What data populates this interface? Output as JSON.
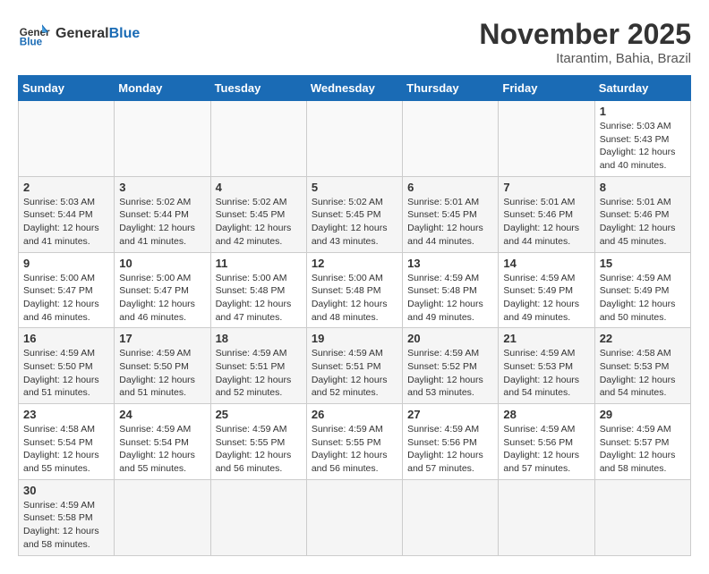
{
  "header": {
    "logo_general": "General",
    "logo_blue": "Blue",
    "month_title": "November 2025",
    "location": "Itarantim, Bahia, Brazil"
  },
  "days_of_week": [
    "Sunday",
    "Monday",
    "Tuesday",
    "Wednesday",
    "Thursday",
    "Friday",
    "Saturday"
  ],
  "weeks": [
    [
      {
        "day": "",
        "info": ""
      },
      {
        "day": "",
        "info": ""
      },
      {
        "day": "",
        "info": ""
      },
      {
        "day": "",
        "info": ""
      },
      {
        "day": "",
        "info": ""
      },
      {
        "day": "",
        "info": ""
      },
      {
        "day": "1",
        "info": "Sunrise: 5:03 AM\nSunset: 5:43 PM\nDaylight: 12 hours and 40 minutes."
      }
    ],
    [
      {
        "day": "2",
        "info": "Sunrise: 5:03 AM\nSunset: 5:44 PM\nDaylight: 12 hours and 41 minutes."
      },
      {
        "day": "3",
        "info": "Sunrise: 5:02 AM\nSunset: 5:44 PM\nDaylight: 12 hours and 41 minutes."
      },
      {
        "day": "4",
        "info": "Sunrise: 5:02 AM\nSunset: 5:45 PM\nDaylight: 12 hours and 42 minutes."
      },
      {
        "day": "5",
        "info": "Sunrise: 5:02 AM\nSunset: 5:45 PM\nDaylight: 12 hours and 43 minutes."
      },
      {
        "day": "6",
        "info": "Sunrise: 5:01 AM\nSunset: 5:45 PM\nDaylight: 12 hours and 44 minutes."
      },
      {
        "day": "7",
        "info": "Sunrise: 5:01 AM\nSunset: 5:46 PM\nDaylight: 12 hours and 44 minutes."
      },
      {
        "day": "8",
        "info": "Sunrise: 5:01 AM\nSunset: 5:46 PM\nDaylight: 12 hours and 45 minutes."
      }
    ],
    [
      {
        "day": "9",
        "info": "Sunrise: 5:00 AM\nSunset: 5:47 PM\nDaylight: 12 hours and 46 minutes."
      },
      {
        "day": "10",
        "info": "Sunrise: 5:00 AM\nSunset: 5:47 PM\nDaylight: 12 hours and 46 minutes."
      },
      {
        "day": "11",
        "info": "Sunrise: 5:00 AM\nSunset: 5:48 PM\nDaylight: 12 hours and 47 minutes."
      },
      {
        "day": "12",
        "info": "Sunrise: 5:00 AM\nSunset: 5:48 PM\nDaylight: 12 hours and 48 minutes."
      },
      {
        "day": "13",
        "info": "Sunrise: 4:59 AM\nSunset: 5:48 PM\nDaylight: 12 hours and 49 minutes."
      },
      {
        "day": "14",
        "info": "Sunrise: 4:59 AM\nSunset: 5:49 PM\nDaylight: 12 hours and 49 minutes."
      },
      {
        "day": "15",
        "info": "Sunrise: 4:59 AM\nSunset: 5:49 PM\nDaylight: 12 hours and 50 minutes."
      }
    ],
    [
      {
        "day": "16",
        "info": "Sunrise: 4:59 AM\nSunset: 5:50 PM\nDaylight: 12 hours and 51 minutes."
      },
      {
        "day": "17",
        "info": "Sunrise: 4:59 AM\nSunset: 5:50 PM\nDaylight: 12 hours and 51 minutes."
      },
      {
        "day": "18",
        "info": "Sunrise: 4:59 AM\nSunset: 5:51 PM\nDaylight: 12 hours and 52 minutes."
      },
      {
        "day": "19",
        "info": "Sunrise: 4:59 AM\nSunset: 5:51 PM\nDaylight: 12 hours and 52 minutes."
      },
      {
        "day": "20",
        "info": "Sunrise: 4:59 AM\nSunset: 5:52 PM\nDaylight: 12 hours and 53 minutes."
      },
      {
        "day": "21",
        "info": "Sunrise: 4:59 AM\nSunset: 5:53 PM\nDaylight: 12 hours and 54 minutes."
      },
      {
        "day": "22",
        "info": "Sunrise: 4:58 AM\nSunset: 5:53 PM\nDaylight: 12 hours and 54 minutes."
      }
    ],
    [
      {
        "day": "23",
        "info": "Sunrise: 4:58 AM\nSunset: 5:54 PM\nDaylight: 12 hours and 55 minutes."
      },
      {
        "day": "24",
        "info": "Sunrise: 4:59 AM\nSunset: 5:54 PM\nDaylight: 12 hours and 55 minutes."
      },
      {
        "day": "25",
        "info": "Sunrise: 4:59 AM\nSunset: 5:55 PM\nDaylight: 12 hours and 56 minutes."
      },
      {
        "day": "26",
        "info": "Sunrise: 4:59 AM\nSunset: 5:55 PM\nDaylight: 12 hours and 56 minutes."
      },
      {
        "day": "27",
        "info": "Sunrise: 4:59 AM\nSunset: 5:56 PM\nDaylight: 12 hours and 57 minutes."
      },
      {
        "day": "28",
        "info": "Sunrise: 4:59 AM\nSunset: 5:56 PM\nDaylight: 12 hours and 57 minutes."
      },
      {
        "day": "29",
        "info": "Sunrise: 4:59 AM\nSunset: 5:57 PM\nDaylight: 12 hours and 58 minutes."
      }
    ],
    [
      {
        "day": "30",
        "info": "Sunrise: 4:59 AM\nSunset: 5:58 PM\nDaylight: 12 hours and 58 minutes."
      },
      {
        "day": "",
        "info": ""
      },
      {
        "day": "",
        "info": ""
      },
      {
        "day": "",
        "info": ""
      },
      {
        "day": "",
        "info": ""
      },
      {
        "day": "",
        "info": ""
      },
      {
        "day": "",
        "info": ""
      }
    ]
  ]
}
